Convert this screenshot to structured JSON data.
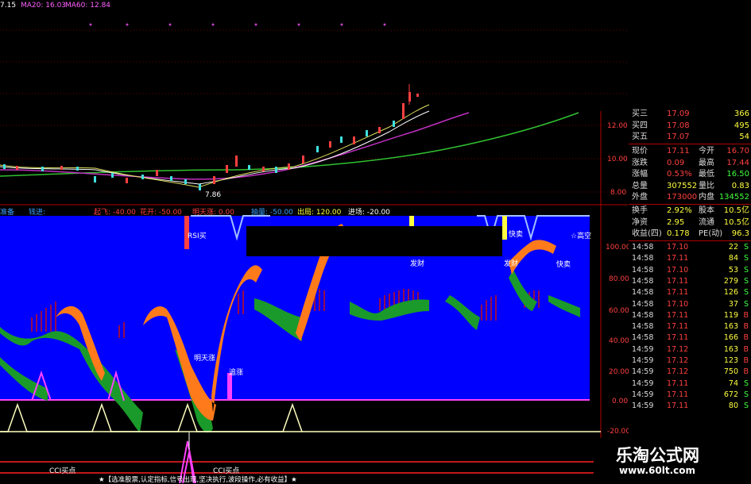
{
  "header": {
    "price_prefix": "7.15",
    "ma20": "MA20: 16.03",
    "ma60": "MA60: 12.84"
  },
  "price_axis": [
    "12.00",
    "10.00",
    "8.00"
  ],
  "low_marker": "7.86",
  "indicator_bar": {
    "items": [
      {
        "text": "准备",
        "color": "#3aa0ff"
      },
      {
        "text": "钱进: ",
        "color": "#3aa0ff"
      },
      {
        "text": "起飞: -40.00",
        "color": "#ff4040"
      },
      {
        "text": "花开: -50.00",
        "color": "#ff4040"
      },
      {
        "text": "明天涨: 0.00",
        "color": "#ff4040"
      },
      {
        "text": "抽量: -50.00",
        "color": "#3aa0ff"
      },
      {
        "text": "出局: 120.00",
        "color": "#ffff40"
      },
      {
        "text": "进场: -20.00",
        "color": "#ffffff"
      }
    ]
  },
  "indicator_axis": [
    "100.00",
    "80.00",
    "60.00",
    "40.00",
    "20.00",
    "0.00",
    "-20.00"
  ],
  "chart_labels": {
    "rsi_buy": "RSI买",
    "fa_cai_1": "发财",
    "fa_cai_2": "发财",
    "kuai_mai": "快卖",
    "kuai_mai_2": "快卖",
    "high_short": "☆高空",
    "ming_tian_zhang": "明天涨",
    "zhui_zhang": "追涨",
    "cci_buy_1": "CCI买点",
    "cci_buy_2": "CCI买点"
  },
  "footer_banner": "★【选准股票,认定指标,信号出现,坚决执行,波段操作,必有收益】★",
  "quote_panel": {
    "book": [
      {
        "label": "买三",
        "price": "17.09",
        "vol": "366"
      },
      {
        "label": "买四",
        "price": "17.08",
        "vol": "495"
      },
      {
        "label": "买五",
        "price": "17.07",
        "vol": "54"
      }
    ],
    "stats": [
      {
        "l1": "现价",
        "v1": "17.11",
        "l2": "今开",
        "v2": "16.70",
        "c1": "#ff4040",
        "c2": "#ff4040"
      },
      {
        "l1": "涨跌",
        "v1": "0.09",
        "l2": "最高",
        "v2": "17.44",
        "c1": "#ff4040",
        "c2": "#ff4040"
      },
      {
        "l1": "涨幅",
        "v1": "0.53%",
        "l2": "最低",
        "v2": "16.50",
        "c1": "#ff4040",
        "c2": "#40ff40"
      },
      {
        "l1": "总量",
        "v1": "307552",
        "l2": "量比",
        "v2": "0.83",
        "c1": "#ffff40",
        "c2": "#ffff40"
      },
      {
        "l1": "外盘",
        "v1": "173000",
        "l2": "内盘",
        "v2": "134552",
        "c1": "#ff4040",
        "c2": "#40ff40"
      },
      {
        "l1": "换手",
        "v1": "2.92%",
        "l2": "股本",
        "v2": "10.5亿",
        "c1": "#ffff40",
        "c2": "#ffff40"
      },
      {
        "l1": "净资",
        "v1": "2.95",
        "l2": "流通",
        "v2": "10.5亿",
        "c1": "#ffff40",
        "c2": "#ffff40"
      },
      {
        "l1": "收益(四)",
        "v1": "0.178",
        "l2": "PE(动)",
        "v2": "96.3",
        "c1": "#ffff40",
        "c2": "#ffff40"
      }
    ],
    "ticks": [
      {
        "time": "14:58",
        "price": "17.10",
        "vol": "22",
        "side": "S"
      },
      {
        "time": "14:58",
        "price": "17.11",
        "vol": "84",
        "side": "S"
      },
      {
        "time": "14:58",
        "price": "17.10",
        "vol": "53",
        "side": "S"
      },
      {
        "time": "14:58",
        "price": "17.11",
        "vol": "279",
        "side": "S"
      },
      {
        "time": "14:58",
        "price": "17.11",
        "vol": "126",
        "side": "S"
      },
      {
        "time": "14:58",
        "price": "17.10",
        "vol": "37",
        "side": "S"
      },
      {
        "time": "14:58",
        "price": "17.11",
        "vol": "119",
        "side": "B"
      },
      {
        "time": "14:58",
        "price": "17.11",
        "vol": "163",
        "side": "B"
      },
      {
        "time": "14:58",
        "price": "17.11",
        "vol": "166",
        "side": "B"
      },
      {
        "time": "14:59",
        "price": "17.12",
        "vol": "163",
        "side": "B"
      },
      {
        "time": "14:59",
        "price": "17.12",
        "vol": "123",
        "side": "B"
      },
      {
        "time": "14:59",
        "price": "17.12",
        "vol": "750",
        "side": "B"
      },
      {
        "time": "14:59",
        "price": "17.11",
        "vol": "74",
        "side": "S"
      },
      {
        "time": "14:59",
        "price": "17.11",
        "vol": "672",
        "side": "S"
      },
      {
        "time": "14:59",
        "price": "17.11",
        "vol": "80",
        "side": "S"
      }
    ]
  },
  "watermark": {
    "title": "乐淘公式网",
    "url": "www.60lt.com"
  },
  "colors": {
    "indicator_bg": "#0000ff",
    "orange_band": "#ff7a1a",
    "green_band": "#1a9a2a",
    "red_bars": "#c81010",
    "ma_short": "#ffffff",
    "ma_mid": "#c030c0",
    "ma_long": "#30c030"
  }
}
